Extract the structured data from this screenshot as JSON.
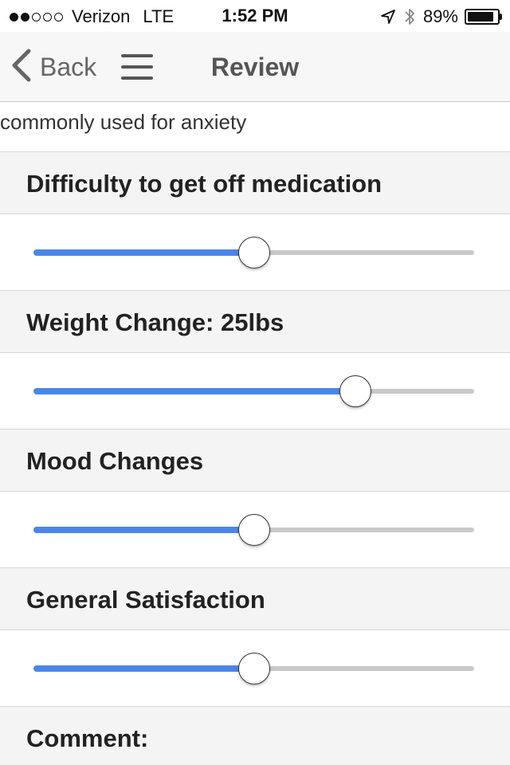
{
  "status_bar": {
    "signal_full": 2,
    "signal_total": 5,
    "carrier": "Verizon",
    "network": "LTE",
    "time": "1:52 PM",
    "battery": "89%",
    "battery_level": 0.89,
    "icons": [
      "location-arrow-icon",
      "bluetooth-icon",
      "battery-icon"
    ]
  },
  "nav": {
    "back_label": "Back",
    "title": "Review",
    "icons": [
      "chevron-left-icon",
      "hamburger-menu-icon"
    ]
  },
  "description": "commonly used for anxiety",
  "sections": [
    {
      "label": "Difficulty to get off medication",
      "value": 0.5
    },
    {
      "label": "Weight Change: 25lbs",
      "value": 0.73
    },
    {
      "label": "Mood Changes",
      "value": 0.5
    },
    {
      "label": "General Satisfaction",
      "value": 0.5
    }
  ],
  "comment_label": "Comment:",
  "colors": {
    "accent": "#4a86e8",
    "track": "#c9c9c9",
    "header_bg": "#f4f4f4",
    "nav_bg": "#f7f7f7"
  }
}
